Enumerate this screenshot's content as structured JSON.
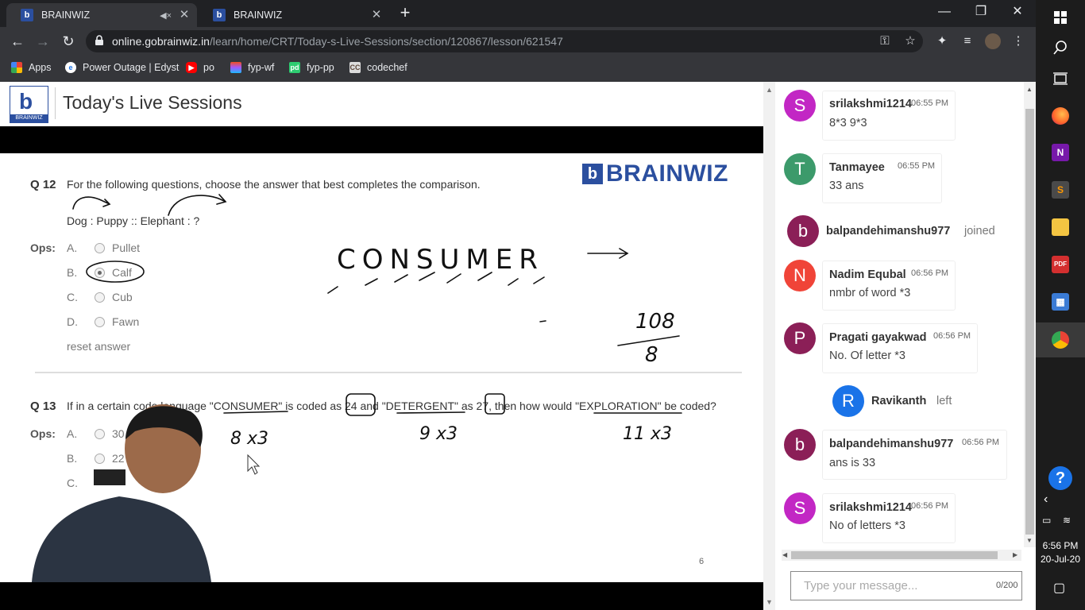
{
  "browser": {
    "tabs": [
      {
        "title": "BRAINWIZ",
        "active": true,
        "muted_audio": true
      },
      {
        "title": "BRAINWIZ",
        "active": false
      }
    ],
    "url_host": "online.gobrainwiz.in",
    "url_path": "/learn/home/CRT/Today-s-Live-Sessions/section/120867/lesson/621547",
    "bookmarks": [
      {
        "label": "Apps",
        "icon": "apps-grid-icon"
      },
      {
        "label": "Power Outage | Edyst",
        "icon": "edyst-icon"
      },
      {
        "label": "po",
        "icon": "youtube-icon"
      },
      {
        "label": "fyp-wf",
        "icon": "figma-icon"
      },
      {
        "label": "fyp-pp",
        "icon": "pd-icon"
      },
      {
        "label": "codechef",
        "icon": "codechef-icon"
      }
    ]
  },
  "page": {
    "title": "Today's Live Sessions",
    "logo_caption": "BRAINWIZ"
  },
  "slide": {
    "brand": "BRAINWIZ",
    "q12": {
      "number": "Q 12",
      "question": "For the following questions, choose the answer that best completes the comparison.",
      "analogy": "Dog : Puppy :: Elephant : ?",
      "ops_label": "Ops:",
      "options": [
        {
          "letter": "A.",
          "text": "Pullet",
          "selected": false
        },
        {
          "letter": "B.",
          "text": "Calf",
          "selected": true
        },
        {
          "letter": "C.",
          "text": "Cub",
          "selected": false
        },
        {
          "letter": "D.",
          "text": "Fawn",
          "selected": false
        }
      ],
      "reset": "reset answer"
    },
    "q13": {
      "number": "Q 13",
      "question": "If in a certain code language \"CONSUMER\" is coded as 24 and \"DETERGENT\" as 27, then how would \"EXPLORATION\" be coded?",
      "ops_label": "Ops:",
      "options": [
        {
          "letter": "A.",
          "text": "30"
        },
        {
          "letter": "B.",
          "text": "22"
        },
        {
          "letter": "C.",
          "text": ""
        }
      ]
    },
    "annotations": {
      "consumer": "CONSUMER",
      "fraction_top": "108",
      "fraction_bottom": "8",
      "calc1": "8 x3",
      "calc2": "9 x3",
      "calc3": "11 x3"
    },
    "page_number": "6"
  },
  "chat": {
    "messages": [
      {
        "type": "msg",
        "initial": "S",
        "color": "#c227c4",
        "user": "srilakshmi1214",
        "time": "06:55 PM",
        "text": "8*3 9*3"
      },
      {
        "type": "msg",
        "initial": "T",
        "color": "#3c9a6b",
        "user": "Tanmayee",
        "time": "06:55 PM",
        "text": "33 ans"
      },
      {
        "type": "status",
        "initial": "b",
        "color": "#8b1f57",
        "user": "balpandehimanshu977",
        "text": "joined"
      },
      {
        "type": "msg",
        "initial": "N",
        "color": "#f04438",
        "user": "Nadim Equbal",
        "time": "06:56 PM",
        "text": "nmbr of word *3"
      },
      {
        "type": "msg",
        "initial": "P",
        "color": "#8b1f57",
        "user": "Pragati gayakwad",
        "time": "06:56 PM",
        "text": "No. Of letter *3"
      },
      {
        "type": "status",
        "initial": "R",
        "color": "#1a73e8",
        "user": "Ravikanth",
        "text": "left"
      },
      {
        "type": "msg",
        "initial": "b",
        "color": "#8b1f57",
        "user": "balpandehimanshu977",
        "time": "06:56 PM",
        "text": "ans is 33"
      },
      {
        "type": "msg",
        "initial": "S",
        "color": "#c227c4",
        "user": "srilakshmi1214",
        "time": "06:56 PM",
        "text": "No of letters *3"
      }
    ],
    "input_placeholder": "Type your message...",
    "char_count": "0/200"
  },
  "taskbar": {
    "time": "6:56 PM",
    "date": "20-Jul-20"
  }
}
